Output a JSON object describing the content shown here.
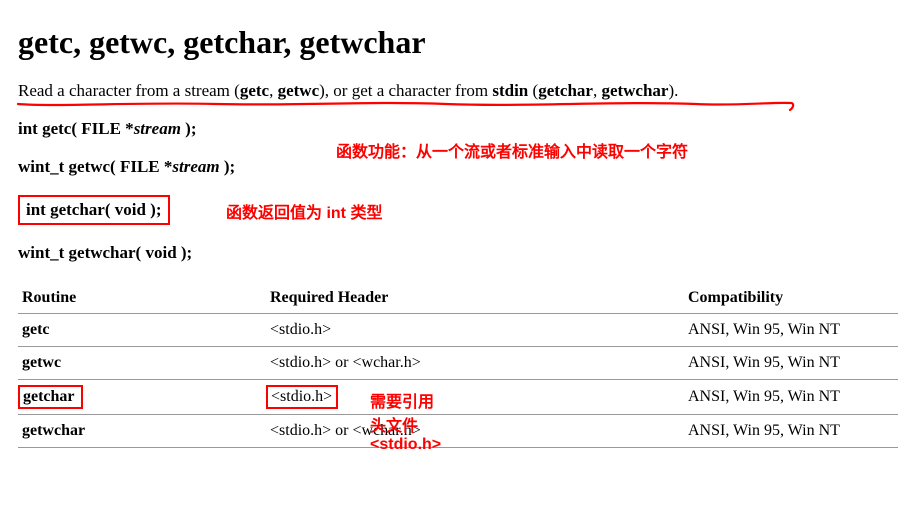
{
  "title": "getc, getwc, getchar, getwchar",
  "description": {
    "t1": "Read a character from a stream (",
    "b1": "getc",
    "sep1": ", ",
    "b2": "getwc",
    "t2": "), or get a character from ",
    "b3": "stdin",
    "t3": " (",
    "b4": "getchar",
    "sep2": ", ",
    "b5": "getwchar",
    "t4": ")."
  },
  "annotations": {
    "func_desc": "函数功能：从一个流或者标准输入中读取一个字符",
    "return_int": "函数返回值为 int 类型",
    "need_header": "需要引用头文件<stdio.h>"
  },
  "prototypes": {
    "p1a": "int getc( FILE *",
    "p1b": "stream",
    "p1c": " );",
    "p2a": "wint_t getwc( FILE *",
    "p2b": "stream",
    "p2c": " );",
    "p3": "int getchar( void );",
    "p4": "wint_t getwchar( void );"
  },
  "table": {
    "headers": {
      "h1": "Routine",
      "h2": "Required Header",
      "h3": "Compatibility"
    },
    "rows": [
      {
        "routine": "getc",
        "header": "<stdio.h>",
        "compat": "ANSI, Win 95, Win NT",
        "boxed": false
      },
      {
        "routine": "getwc",
        "header": "<stdio.h> or <wchar.h>",
        "compat": "ANSI, Win 95, Win NT",
        "boxed": false
      },
      {
        "routine": "getchar",
        "header": "<stdio.h>",
        "compat": "ANSI, Win 95, Win NT",
        "boxed": true
      },
      {
        "routine": "getwchar",
        "header": "<stdio.h> or <wchar.h>",
        "compat": "ANSI, Win 95, Win NT",
        "boxed": false
      }
    ]
  }
}
